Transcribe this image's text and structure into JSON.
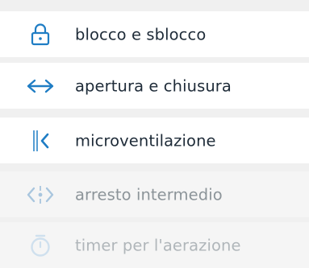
{
  "menu": {
    "items": [
      {
        "label": "blocco e sblocco",
        "icon": "lock-icon",
        "state": "enabled",
        "icon_color": "#1f7dc4"
      },
      {
        "label": "apertura e chiusura",
        "icon": "open-close-arrows-icon",
        "state": "enabled",
        "icon_color": "#1f7dc4"
      },
      {
        "label": "microventilazione",
        "icon": "micro-ventilation-icon",
        "state": "enabled",
        "icon_color": "#1f7dc4"
      },
      {
        "label": "arresto intermedio",
        "icon": "intermediate-stop-icon",
        "state": "disabled",
        "icon_color": "#a9c6de"
      },
      {
        "label": "timer per l'aerazione",
        "icon": "timer-icon",
        "state": "disabled",
        "icon_color": "#cfe0ee"
      }
    ]
  },
  "colors": {
    "accent": "#1f7dc4",
    "text": "#1e2b38",
    "text_disabled": "#8c9499",
    "text_faint": "#b0b6ba",
    "row_background": "#ffffff",
    "row_disabled_background": "#f5f5f5",
    "separator": "#f0f0f0"
  }
}
